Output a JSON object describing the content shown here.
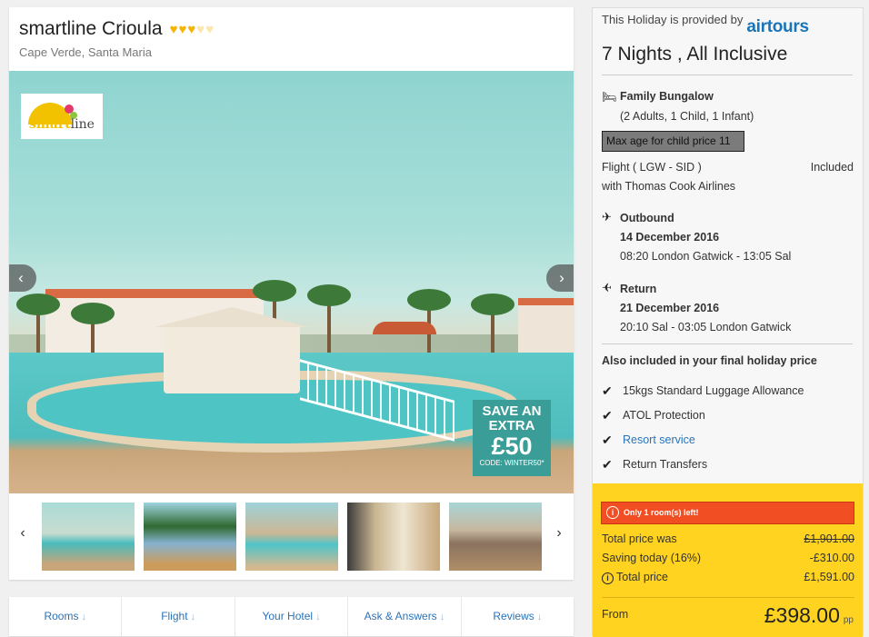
{
  "hotel": {
    "name": "smartline Crioula",
    "rating_full": 3,
    "rating_total": 5,
    "location": "Cape Verde, Santa Maria",
    "logo_text_1": "smart",
    "logo_text_2": "line"
  },
  "gallery": {
    "prev": "‹",
    "next": "›",
    "promo": {
      "line1": "SAVE AN",
      "line2": "EXTRA",
      "amount": "£50",
      "code": "CODE: WINTER50*"
    },
    "thumb_prev": "‹",
    "thumb_next": "›"
  },
  "tabs": [
    {
      "label": "Rooms"
    },
    {
      "label": "Flight"
    },
    {
      "label": "Your Hotel"
    },
    {
      "label": "Ask & Answers"
    },
    {
      "label": "Reviews"
    }
  ],
  "panel": {
    "provided_by": "This Holiday is provided by",
    "provider": "airtours",
    "duration": "7 Nights , All Inclusive",
    "room_type": "Family Bungalow",
    "occupancy": "(2 Adults, 1 Child, 1 Infant)",
    "max_age": "Max age for child price 11",
    "flight_label": "Flight ( LGW - SID )",
    "flight_included": "Included",
    "airline": "with Thomas Cook Airlines",
    "outbound_label": "Outbound",
    "outbound_date": "14 December 2016",
    "outbound_times": "08:20 London Gatwick - 13:05 Sal",
    "return_label": "Return",
    "return_date": "21 December 2016",
    "return_times": "20:10 Sal - 03:05 London Gatwick",
    "also_included": "Also included in your final holiday price",
    "inclusions": [
      {
        "label": "15kgs Standard Luggage Allowance",
        "link": false
      },
      {
        "label": "ATOL Protection",
        "link": false
      },
      {
        "label": "Resort service",
        "link": true
      },
      {
        "label": "Return Transfers",
        "link": false
      }
    ]
  },
  "pricing": {
    "alert": "Only 1 room(s) left!",
    "total_was_label": "Total price was",
    "total_was_value": "£1,901.00",
    "saving_label": "Saving today (16%)",
    "saving_value": "-£310.00",
    "total_label": "Total price",
    "total_value": "£1,591.00",
    "from_label": "From",
    "from_value": "£398.00",
    "per": "pp"
  },
  "colors": {
    "accent": "#2a73b8",
    "price_box": "#ffd320",
    "alert": "#f14e24",
    "promo": "#3a9d97"
  }
}
